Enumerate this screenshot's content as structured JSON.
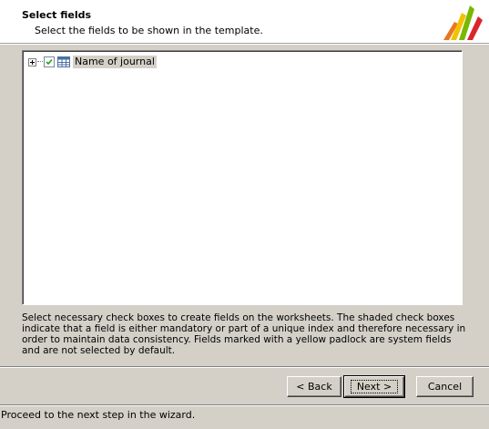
{
  "header": {
    "title": "Select fields",
    "subtitle": "Select the fields to be shown in the template."
  },
  "tree": {
    "items": [
      {
        "label": "Name of journal",
        "checked": true,
        "expandable": true
      }
    ]
  },
  "info_text": "Select necessary check boxes to create fields on the worksheets. The shaded check boxes indicate that a field is either mandatory or part of a unique index and therefore necessary in order to maintain data consistency. Fields marked with a yellow padlock are system fields and are not selected by default.",
  "buttons": {
    "back": "< Back",
    "next": "Next >",
    "cancel": "Cancel"
  },
  "status_bar": {
    "text": "Proceed to the next step in the wizard."
  },
  "colors": {
    "logo_orange": "#e87722",
    "logo_yellow": "#f2c200",
    "logo_green": "#7ab800",
    "logo_red": "#d9262c"
  }
}
